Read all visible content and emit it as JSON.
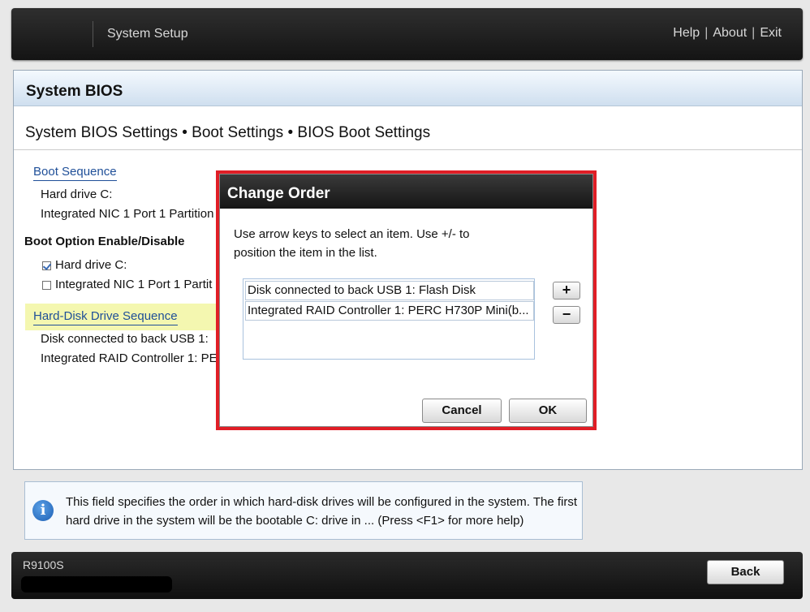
{
  "header": {
    "title": "System Setup",
    "links": [
      "Help",
      "About",
      "Exit"
    ],
    "separator": "|"
  },
  "panel": {
    "title": "System BIOS",
    "breadcrumb": "System BIOS Settings • Boot Settings • BIOS Boot Settings",
    "boot_sequence": {
      "label": "Boot Sequence",
      "items": [
        "Hard drive C:",
        "Integrated NIC 1 Port 1 Partition"
      ]
    },
    "boot_option": {
      "label": "Boot Option Enable/Disable",
      "items": [
        {
          "label": "Hard drive C:",
          "checked": true
        },
        {
          "label": "Integrated NIC 1 Port 1 Partit",
          "checked": false
        }
      ]
    },
    "hdd_sequence": {
      "label": "Hard-Disk Drive Sequence",
      "items": [
        "Disk connected to back USB 1:",
        "Integrated RAID Controller 1: PE"
      ]
    }
  },
  "dialog": {
    "title": "Change Order",
    "message": "Use arrow keys to select an item. Use +/- to position the item in the list.",
    "list": [
      "Disk connected to back USB 1: Flash Disk",
      "Integrated RAID Controller 1: PERC H730P Mini(b..."
    ],
    "plus": "+",
    "minus": "−",
    "cancel": "Cancel",
    "ok": "OK"
  },
  "info": {
    "icon": "info-icon",
    "text": "This field specifies the order in which hard-disk drives will be configured in the system. The first hard drive in the system will be the bootable C: drive in ... (Press <F1> for more help)"
  },
  "footer": {
    "model": "R9100S",
    "back": "Back"
  },
  "colors": {
    "dialog_border": "#e01e26",
    "link": "#1f4f98",
    "highlight": "#f4f7b0"
  }
}
